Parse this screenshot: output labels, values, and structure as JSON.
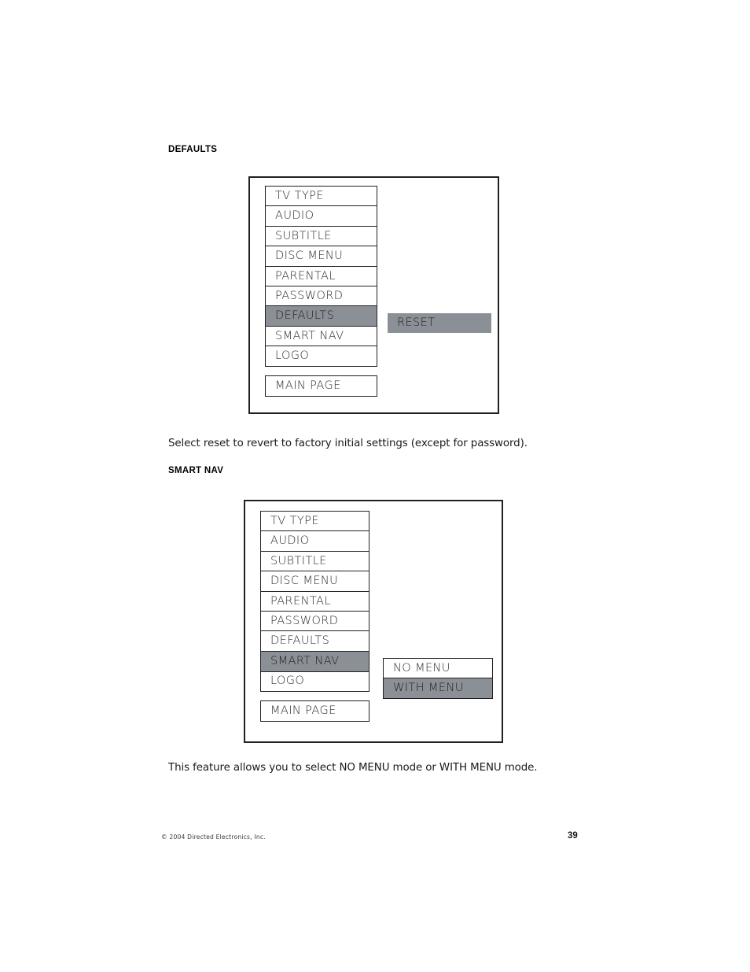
{
  "page": {
    "number": "39",
    "copyright": "© 2004  Directed Electronics, Inc."
  },
  "sections": [
    {
      "heading": "DEFAULTS",
      "paragraph": "Select reset to revert to factory initial settings (except for password).",
      "menu": {
        "items": [
          {
            "label": "TV TYPE",
            "selected": false
          },
          {
            "label": "AUDIO",
            "selected": false
          },
          {
            "label": "SUBTITLE",
            "selected": false
          },
          {
            "label": "DISC MENU",
            "selected": false
          },
          {
            "label": "PARENTAL",
            "selected": false
          },
          {
            "label": "PASSWORD",
            "selected": false
          },
          {
            "label": "DEFAULTS",
            "selected": true
          },
          {
            "label": "SMART NAV",
            "selected": false
          },
          {
            "label": "LOGO",
            "selected": false
          },
          {
            "label": "MAIN PAGE",
            "selected": false
          }
        ]
      },
      "submenu": {
        "items": [
          {
            "label": "RESET",
            "selected": true
          }
        ]
      }
    },
    {
      "heading": "SMART NAV",
      "paragraph": "This feature allows you to select NO MENU mode or WITH MENU mode.",
      "menu": {
        "items": [
          {
            "label": "TV TYPE",
            "selected": false
          },
          {
            "label": "AUDIO",
            "selected": false
          },
          {
            "label": "SUBTITLE",
            "selected": false
          },
          {
            "label": "DISC MENU",
            "selected": false
          },
          {
            "label": "PARENTAL",
            "selected": false
          },
          {
            "label": "PASSWORD",
            "selected": false
          },
          {
            "label": "DEFAULTS",
            "selected": false
          },
          {
            "label": "SMART NAV",
            "selected": true
          },
          {
            "label": "LOGO",
            "selected": false
          },
          {
            "label": "MAIN PAGE",
            "selected": false
          }
        ]
      },
      "submenu": {
        "items": [
          {
            "label": "NO MENU",
            "selected": false
          },
          {
            "label": "WITH MENU",
            "selected": true
          }
        ]
      }
    }
  ],
  "colors": {
    "highlight": "#8b9096",
    "line": "#231f20",
    "text": "#2b2b2b",
    "background": "#ffffff"
  }
}
